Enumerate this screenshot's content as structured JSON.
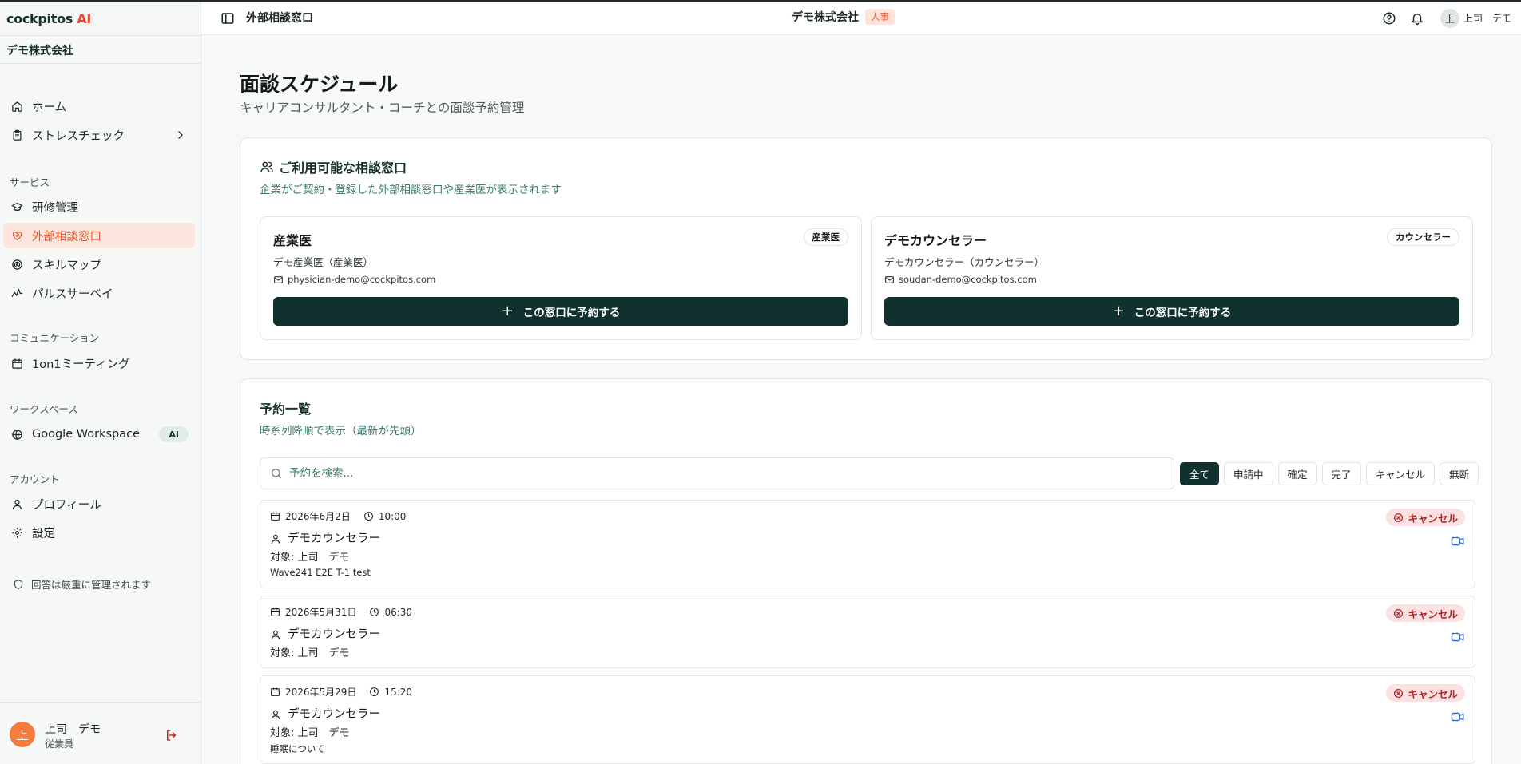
{
  "app": {
    "logo_main": "cockpitos",
    "logo_ai": "AI"
  },
  "sidebar": {
    "company": "デモ株式会社",
    "home": "ホーム",
    "stress": "ストレスチェック",
    "section_service": "サービス",
    "training": "研修管理",
    "external": "外部相談窓口",
    "skillmap": "スキルマップ",
    "pulse": "パルスサーベイ",
    "section_comm": "コミュニケーション",
    "oneonone": "1on1ミーティング",
    "section_workspace": "ワークスペース",
    "google": "Google Workspace",
    "google_badge": "AI",
    "section_account": "アカウント",
    "profile": "プロフィール",
    "settings": "設定",
    "note": "回答は厳重に管理されます",
    "user_initial": "上",
    "user_name": "上司　デモ",
    "user_role": "従業員"
  },
  "header": {
    "title": "外部相談窓口",
    "company": "デモ株式会社",
    "dept_badge": "人事",
    "avatar_initial": "上",
    "user": "上司　デモ"
  },
  "main": {
    "title": "面談スケジュール",
    "subtitle": "キャリアコンサルタント・コーチとの面談予約管理"
  },
  "consultations": {
    "title": "ご利用可能な相談窓口",
    "desc": "企業がご契約・登録した外部相談窓口や産業医が表示されます",
    "items": [
      {
        "name": "産業医",
        "badge": "産業医",
        "sub": "デモ産業医（産業医）",
        "email": "physician-demo@cockpitos.com",
        "button": "この窓口に予約する"
      },
      {
        "name": "デモカウンセラー",
        "badge": "カウンセラー",
        "sub": "デモカウンセラー（カウンセラー）",
        "email": "soudan-demo@cockpitos.com",
        "button": "この窓口に予約する"
      }
    ]
  },
  "reservations": {
    "title": "予約一覧",
    "desc": "時系列降順で表示（最新が先頭）",
    "search_placeholder": "予約を検索...",
    "filters": [
      "全て",
      "申請中",
      "確定",
      "完了",
      "キャンセル",
      "無断"
    ],
    "active_filter": "全て",
    "items": [
      {
        "date": "2026年6月2日",
        "time": "10:00",
        "counselor": "デモカウンセラー",
        "target": "対象: 上司　デモ",
        "note": "Wave241 E2E T-1 test",
        "status": "キャンセル"
      },
      {
        "date": "2026年5月31日",
        "time": "06:30",
        "counselor": "デモカウンセラー",
        "target": "対象: 上司　デモ",
        "note": "",
        "status": "キャンセル"
      },
      {
        "date": "2026年5月29日",
        "time": "15:20",
        "counselor": "デモカウンセラー",
        "target": "対象: 上司　デモ",
        "note": "睡眠について",
        "status": "キャンセル"
      }
    ]
  },
  "colors": {
    "primary_dark": "#10312d",
    "accent_orange": "#e5572f",
    "active_bg": "#fbe5dc",
    "teal_text": "#3a7b6e",
    "cancel_bg": "#fbe1e1",
    "cancel_text": "#b42323",
    "video_blue": "#2f6fe0"
  },
  "icons": {
    "home": "home-icon",
    "stress": "clipboard-icon",
    "training": "graduation-cap-icon",
    "external": "heart-handshake-icon",
    "skillmap": "target-icon",
    "pulse": "pulse-icon",
    "oneonone": "calendar-icon",
    "google": "globe-icon",
    "profile": "user-icon",
    "settings": "gear-icon",
    "note": "shield-icon",
    "logout": "logout-icon",
    "sidebar_toggle": "panel-left-icon",
    "help": "help-circle-icon",
    "bell": "bell-icon",
    "users": "users-icon",
    "mail": "mail-icon",
    "search": "search-icon",
    "calendar": "calendar-icon",
    "clock": "clock-icon",
    "person": "user-icon",
    "cancel": "x-circle-icon",
    "video": "video-icon"
  }
}
